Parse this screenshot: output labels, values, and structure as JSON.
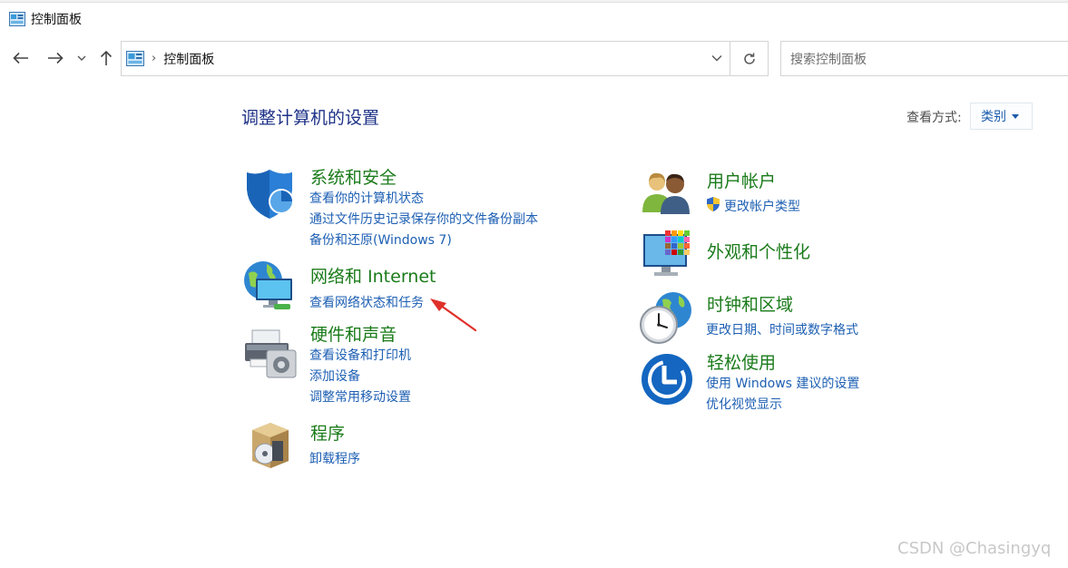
{
  "window": {
    "title": "控制面板"
  },
  "nav": {
    "back": "←",
    "forward": "→",
    "recent": "⌄",
    "up": "↑"
  },
  "address": {
    "crumb": "控制面板",
    "separator": "›"
  },
  "search": {
    "placeholder": "搜索控制面板"
  },
  "main": {
    "heading": "调整计算机的设置",
    "view_by_label": "查看方式:",
    "view_by_value": "类别"
  },
  "left_categories": [
    {
      "title": "系统和安全",
      "links": [
        "查看你的计算机状态",
        "通过文件历史记录保存你的文件备份副本",
        "备份和还原(Windows 7)"
      ]
    },
    {
      "title": "网络和 Internet",
      "links": [
        "查看网络状态和任务"
      ]
    },
    {
      "title": "硬件和声音",
      "links": [
        "查看设备和打印机",
        "添加设备",
        "调整常用移动设置"
      ]
    },
    {
      "title": "程序",
      "links": [
        "卸载程序"
      ]
    }
  ],
  "right_categories": [
    {
      "title": "用户帐户",
      "links": [
        "更改帐户类型"
      ]
    },
    {
      "title": "外观和个性化",
      "links": []
    },
    {
      "title": "时钟和区域",
      "links": [
        "更改日期、时间或数字格式"
      ]
    },
    {
      "title": "轻松使用",
      "links": [
        "使用 Windows 建议的设置",
        "优化视觉显示"
      ]
    }
  ],
  "watermark": "CSDN @Chasingyq",
  "colors": {
    "category_title": "#1a7b1a",
    "link": "#1d5fb3",
    "heading": "#1e3287",
    "annotation_arrow": "#e0302a"
  }
}
